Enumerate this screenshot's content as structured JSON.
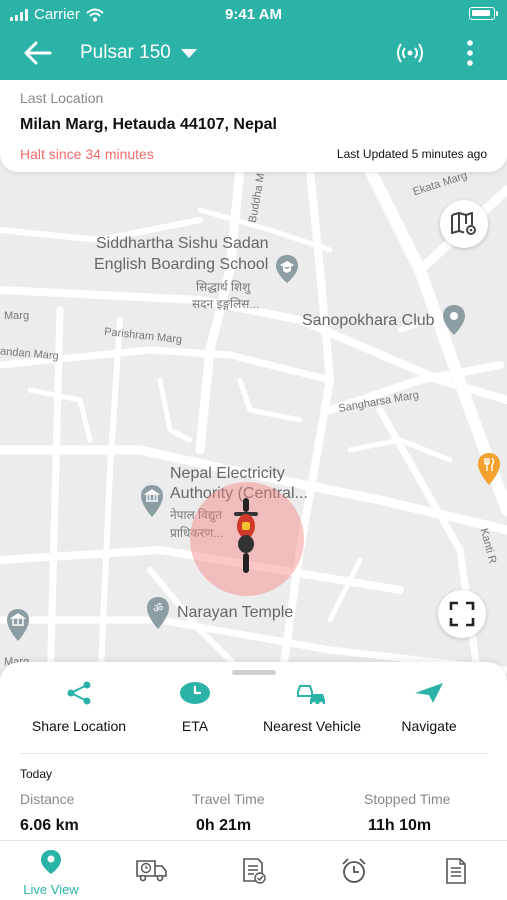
{
  "status_bar": {
    "carrier": "Carrier",
    "time": "9:41 AM"
  },
  "header": {
    "vehicle_name": "Pulsar 150"
  },
  "location": {
    "label": "Last Location",
    "address": "Milan Marg, Hetauda 44107, Nepal",
    "halt": "Halt since 34 minutes",
    "updated": "Last Updated 5 minutes ago"
  },
  "map": {
    "roads": [
      "Ekata Marg",
      "Buddha M",
      "Marg",
      "Parishram Marg",
      "andan Marg",
      "Sangharsa Marg",
      "Kanti R",
      "Marg"
    ],
    "pois": {
      "school_en_1": "Siddhartha Sishu Sadan",
      "school_en_2": "English Boarding School",
      "school_dev_1": "सिद्धार्थ शिशु",
      "school_dev_2": "सदन इङ्गलिस...",
      "club": "Sanopokhara Club",
      "nea_en_1": "Nepal Electricity",
      "nea_en_2": "Authority (Central...",
      "nea_dev_1": "नेपाल विद्युत",
      "nea_dev_2": "प्राधिकरण...",
      "temple": "Narayan Temple"
    }
  },
  "actions": [
    {
      "label": "Share Location",
      "icon": "share-icon"
    },
    {
      "label": "ETA",
      "icon": "clock-icon"
    },
    {
      "label": "Nearest Vehicle",
      "icon": "cars-icon"
    },
    {
      "label": "Navigate",
      "icon": "navigate-icon"
    }
  ],
  "summary": {
    "period": "Today",
    "distance_label": "Distance",
    "distance_value": "6.06 km",
    "travel_label": "Travel Time",
    "travel_value": "0h 21m",
    "stopped_label": "Stopped Time",
    "stopped_value": "11h 10m"
  },
  "nav": {
    "live_view": "Live View"
  },
  "colors": {
    "primary": "#2bb3a8",
    "halt_red": "#f26b6b",
    "pulse": "#f68282"
  }
}
